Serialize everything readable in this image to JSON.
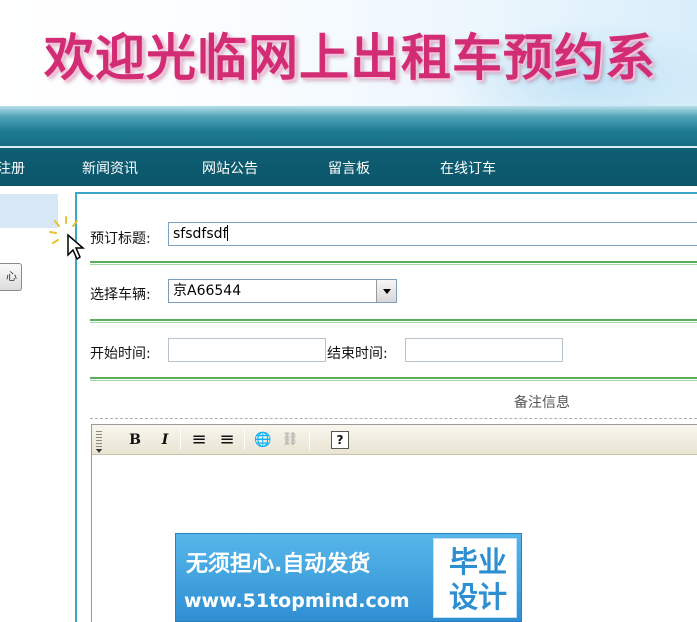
{
  "banner": {
    "title": "欢迎光临网上出租车预约系"
  },
  "nav": {
    "items": [
      "注册",
      "新闻资讯",
      "网站公告",
      "留言板",
      "在线订车"
    ]
  },
  "sidebar": {
    "button_label": "心"
  },
  "form": {
    "title_label": "预订标题:",
    "title_value": "sfsdfsdf",
    "vehicle_label": "选择车辆:",
    "vehicle_selected": "京A66544",
    "start_label": "开始时间:",
    "start_value": "",
    "end_label": "结束时间:",
    "end_value": "",
    "remark_label": "备注信息"
  },
  "editor": {
    "toolbar": [
      {
        "name": "bold-button",
        "glyph": "B"
      },
      {
        "name": "italic-button",
        "glyph": "I"
      },
      {
        "name": "ordered-list-button",
        "glyph": "≡"
      },
      {
        "name": "unordered-list-button",
        "glyph": "≡"
      },
      {
        "name": "link-button",
        "glyph": "🌐"
      },
      {
        "name": "unlink-button",
        "glyph": "⛓"
      },
      {
        "name": "help-button",
        "glyph": "?"
      }
    ]
  },
  "watermark": {
    "line1": "无须担心.自动发货",
    "line2": "www.51topmind.com",
    "box_text": "毕业设计"
  },
  "colors": {
    "banner_title": "#d22c74",
    "nav_bg": "#0f5f75",
    "panel_border": "#3aa7c7",
    "separator": "#5cae5c"
  }
}
